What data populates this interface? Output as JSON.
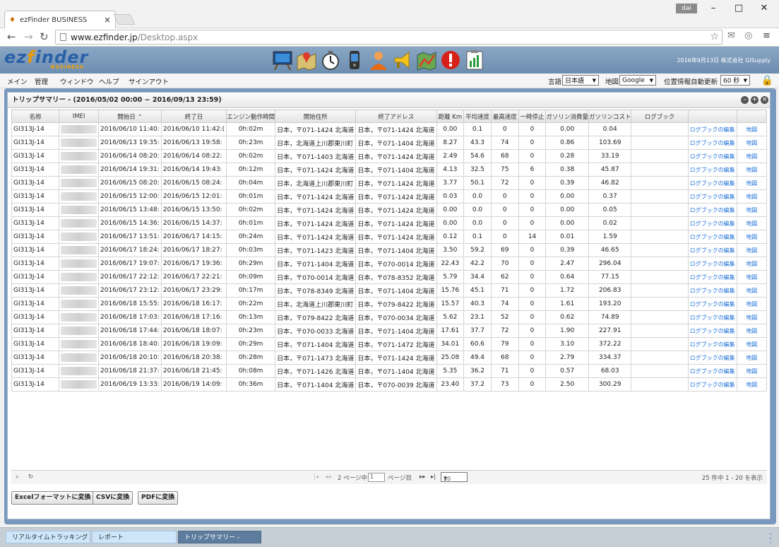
{
  "browser": {
    "tab_title": "ezFinder BUSINESS",
    "user_badge": "dai",
    "url_host": "www.ezfinder.jp",
    "url_path": "/Desktop.aspx"
  },
  "header": {
    "logo_main_1": "ez",
    "logo_accent": "f",
    "logo_main_2": "inder",
    "logo_sub": "BUSINESS",
    "right_text": "2016年9月13日  株式会社 GISupply"
  },
  "menu": {
    "items": [
      "メイン",
      "管理",
      "ウィンドウ",
      "ヘルプ",
      "サインアウト"
    ],
    "language_label": "言語",
    "language_value": "日本語",
    "map_label": "地図",
    "map_value": "Google",
    "refresh_label": "位置情報自動更新",
    "refresh_value": "60 秒"
  },
  "panel": {
    "title": "トリップサマリー - (2016/05/02 00:00 ~ 2016/09/13 23:59)"
  },
  "table": {
    "headers": [
      "名称",
      "IMEI",
      "開始日 ⌃",
      "終了日",
      "エンジン動作時間",
      "開始住所",
      "終了アドレス",
      "距離 Km",
      "平均速度",
      "最高速度",
      "一時停止",
      "ガソリン消費量",
      "ガソリンコスト",
      "ログブック",
      "",
      ""
    ],
    "link_logbook": "ログブックの編集",
    "link_map": "地図",
    "rows": [
      [
        "GI313J-14",
        "2016/06/10 11:40:",
        "2016/06/10 11:42:(",
        "0h:02m",
        "日本，〒071-1424 北海道",
        "日本，〒071-1424 北海道",
        "0.00",
        "0.1",
        "0",
        "0",
        "0.00",
        "0.04"
      ],
      [
        "GI313J-14",
        "2016/06/13 19:35:",
        "2016/06/13 19:58:",
        "0h:23m",
        "日本，北海道上川郡東川町",
        "日本，〒071-1404 北海道",
        "8.27",
        "43.3",
        "74",
        "0",
        "0.86",
        "103.69"
      ],
      [
        "GI313J-14",
        "2016/06/14 08:20:",
        "2016/06/14 08:22:",
        "0h:02m",
        "日本，〒071-1403 北海道",
        "日本，〒071-1424 北海道",
        "2.49",
        "54.6",
        "68",
        "0",
        "0.28",
        "33.19"
      ],
      [
        "GI313J-14",
        "2016/06/14 19:31:",
        "2016/06/14 19:43:",
        "0h:12m",
        "日本，〒071-1424 北海道",
        "日本，〒071-1404 北海道",
        "4.13",
        "32.5",
        "75",
        "6",
        "0.38",
        "45.87"
      ],
      [
        "GI313J-14",
        "2016/06/15 08:20:",
        "2016/06/15 08:24:",
        "0h:04m",
        "日本，北海道上川郡東川町",
        "日本，〒071-1424 北海道",
        "3.77",
        "50.1",
        "72",
        "0",
        "0.39",
        "46.82"
      ],
      [
        "GI313J-14",
        "2016/06/15 12:00:",
        "2016/06/15 12:01:",
        "0h:01m",
        "日本，〒071-1424 北海道",
        "日本，〒071-1424 北海道",
        "0.03",
        "0.0",
        "0",
        "0",
        "0.00",
        "0.37"
      ],
      [
        "GI313J-14",
        "2016/06/15 13:48:",
        "2016/06/15 13:50:",
        "0h:02m",
        "日本，〒071-1424 北海道",
        "日本，〒071-1424 北海道",
        "0.00",
        "0.0",
        "0",
        "0",
        "0.00",
        "0.05"
      ],
      [
        "GI313J-14",
        "2016/06/15 14:36:",
        "2016/06/15 14:37:",
        "0h:01m",
        "日本，〒071-1424 北海道",
        "日本，〒071-1424 北海道",
        "0.00",
        "0.0",
        "0",
        "0",
        "0.00",
        "0.02"
      ],
      [
        "GI313J-14",
        "2016/06/17 13:51:",
        "2016/06/17 14:15:",
        "0h:24m",
        "日本，〒071-1424 北海道",
        "日本，〒071-1424 北海道",
        "0.12",
        "0.1",
        "0",
        "14",
        "0.01",
        "1.59"
      ],
      [
        "GI313J-14",
        "2016/06/17 18:24:",
        "2016/06/17 18:27:",
        "0h:03m",
        "日本，〒071-1423 北海道",
        "日本，〒071-1404 北海道",
        "3.50",
        "59.2",
        "69",
        "0",
        "0.39",
        "46.65"
      ],
      [
        "GI313J-14",
        "2016/06/17 19:07:",
        "2016/06/17 19:36:",
        "0h:29m",
        "日本，〒071-1404 北海道",
        "日本，〒070-0014 北海道",
        "22.43",
        "42.2",
        "70",
        "0",
        "2.47",
        "296.04"
      ],
      [
        "GI313J-14",
        "2016/06/17 22:12:",
        "2016/06/17 22:21:",
        "0h:09m",
        "日本，〒070-0014 北海道",
        "日本，〒078-8352 北海道",
        "5.79",
        "34.4",
        "62",
        "0",
        "0.64",
        "77.15"
      ],
      [
        "GI313J-14",
        "2016/06/17 23:12:",
        "2016/06/17 23:29:",
        "0h:17m",
        "日本，〒078-8349 北海道",
        "日本，〒071-1404 北海道",
        "15.76",
        "45.1",
        "71",
        "0",
        "1.72",
        "206.83"
      ],
      [
        "GI313J-14",
        "2016/06/18 15:55:",
        "2016/06/18 16:17:",
        "0h:22m",
        "日本，北海道上川郡東川町",
        "日本，〒079-8422 北海道",
        "15.57",
        "40.3",
        "74",
        "0",
        "1.61",
        "193.20"
      ],
      [
        "GI313J-14",
        "2016/06/18 17:03:",
        "2016/06/18 17:16:",
        "0h:13m",
        "日本，〒079-8422 北海道",
        "日本，〒070-0034 北海道",
        "5.62",
        "23.1",
        "52",
        "0",
        "0.62",
        "74.89"
      ],
      [
        "GI313J-14",
        "2016/06/18 17:44:",
        "2016/06/18 18:07:",
        "0h:23m",
        "日本，〒070-0033 北海道",
        "日本，〒071-1404 北海道",
        "17.61",
        "37.7",
        "72",
        "0",
        "1.90",
        "227.91"
      ],
      [
        "GI313J-14",
        "2016/06/18 18:40:",
        "2016/06/18 19:09:",
        "0h:29m",
        "日本，〒071-1404 北海道",
        "日本，〒071-1472 北海道",
        "34.01",
        "60.6",
        "79",
        "0",
        "3.10",
        "372.22"
      ],
      [
        "GI313J-14",
        "2016/06/18 20:10:",
        "2016/06/18 20:38:",
        "0h:28m",
        "日本，〒071-1473 北海道",
        "日本，〒071-1424 北海道",
        "25.08",
        "49.4",
        "68",
        "0",
        "2.79",
        "334.37"
      ],
      [
        "GI313J-14",
        "2016/06/18 21:37:",
        "2016/06/18 21:45:",
        "0h:08m",
        "日本，〒071-1426 北海道",
        "日本，〒071-1404 北海道",
        "5.35",
        "36.2",
        "71",
        "0",
        "0.57",
        "68.03"
      ],
      [
        "GI313J-14",
        "2016/06/19 13:33:",
        "2016/06/19 14:09:",
        "0h:36m",
        "日本，〒071-1404 北海道",
        "日本，〒070-0039 北海道",
        "23.40",
        "37.2",
        "73",
        "0",
        "2.50",
        "300.29"
      ]
    ]
  },
  "pager": {
    "pages_of": "2 ページ中",
    "current_page": "1",
    "page_suffix": "ページ目",
    "page_size": "20",
    "summary": "25 件中 1 - 20 を表示"
  },
  "export": {
    "excel": "Excelフォーマットに変換",
    "csv": "CSVに変換",
    "pdf": "PDFに変換"
  },
  "taskbar": {
    "items": [
      "リアルタイムトラッキング",
      "レポート",
      "トリップサマリー -"
    ]
  }
}
